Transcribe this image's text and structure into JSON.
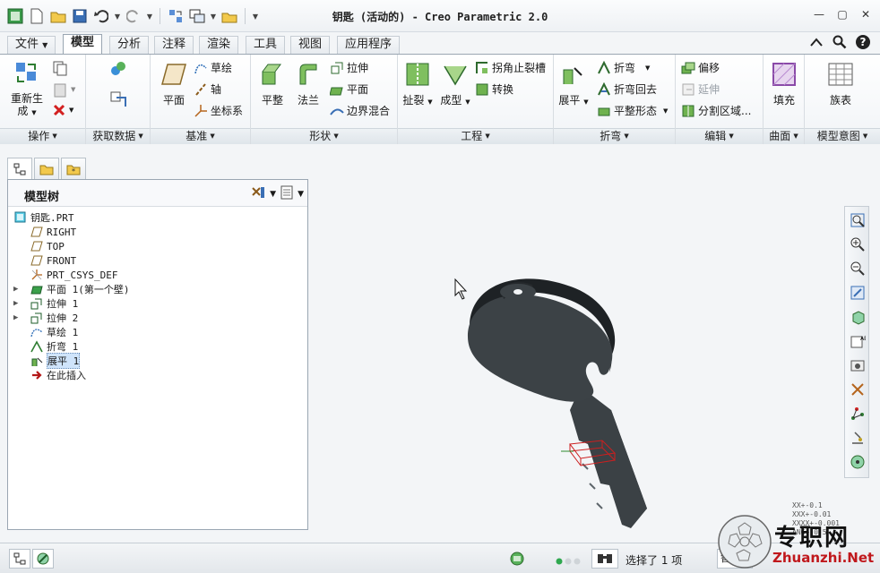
{
  "window": {
    "title": "钥匙 (活动的) - Creo Parametric 2.0"
  },
  "tabs": [
    "文件",
    "模型",
    "分析",
    "注释",
    "渲染",
    "工具",
    "视图",
    "应用程序"
  ],
  "active_tab": "模型",
  "ribbon": {
    "operations": {
      "label": "操作",
      "regen": "重新生",
      "regen2": "成"
    },
    "get_data": {
      "label": "获取数据"
    },
    "datum": {
      "label": "基准",
      "plane": "平面",
      "sketch": "草绘",
      "axis": "轴",
      "csys": "坐标系"
    },
    "shapes": {
      "label": "形状",
      "flat": "平整",
      "flange": "法兰",
      "extrude": "拉伸",
      "plane": "平面",
      "blend": "边界混合"
    },
    "engineering": {
      "label": "工程",
      "rip": "扯裂",
      "form": "成型",
      "corner_relief": "拐角止裂槽",
      "convert": "转换"
    },
    "bends": {
      "label": "折弯",
      "unbend": "展平",
      "bend": "折弯",
      "bend_back": "折弯回去",
      "flat_pattern": "平整形态"
    },
    "editing": {
      "label": "编辑",
      "offset": "偏移",
      "extend": "延伸",
      "split": "分割区域..."
    },
    "surfaces": {
      "label": "曲面",
      "fill": "填充"
    },
    "model_intent": {
      "label": "模型意图",
      "family": "族表"
    }
  },
  "navigator": {
    "title": "模型树",
    "items": [
      {
        "label": "钥匙.PRT",
        "icon": "part-icon",
        "expandable": false,
        "indent": 0
      },
      {
        "label": "RIGHT",
        "icon": "datum-plane-icon",
        "expandable": false,
        "indent": 1
      },
      {
        "label": "TOP",
        "icon": "datum-plane-icon",
        "expandable": false,
        "indent": 1
      },
      {
        "label": "FRONT",
        "icon": "datum-plane-icon",
        "expandable": false,
        "indent": 1
      },
      {
        "label": "PRT_CSYS_DEF",
        "icon": "csys-icon",
        "expandable": false,
        "indent": 1
      },
      {
        "label": "平面 1(第一个壁)",
        "icon": "flat-wall-icon",
        "expandable": true,
        "indent": 1
      },
      {
        "label": "拉伸 1",
        "icon": "extrude-icon",
        "expandable": true,
        "indent": 1
      },
      {
        "label": "拉伸 2",
        "icon": "extrude-icon",
        "expandable": true,
        "indent": 1
      },
      {
        "label": "草绘 1",
        "icon": "sketch-icon",
        "expandable": false,
        "indent": 1
      },
      {
        "label": "折弯 1",
        "icon": "bend-icon",
        "expandable": false,
        "indent": 1
      },
      {
        "label": "展平 1",
        "icon": "unbend-icon",
        "expandable": false,
        "indent": 1,
        "selected": true
      },
      {
        "label": "在此插入",
        "icon": "insert-here-icon",
        "expandable": false,
        "indent": 1
      }
    ]
  },
  "coords": [
    "XX+-0.1",
    "XXX+-0.01",
    "XXXX+-0.001",
    "ANG+-0.5"
  ],
  "status": {
    "text": "选择了 1 项",
    "filter": "智能"
  },
  "watermark": {
    "text": "专职网",
    "url": "Zhuanzhi.Net"
  },
  "colors": {
    "accent": "#2e7d32",
    "selection": "#cc1f1f",
    "model": "#3c4246"
  }
}
